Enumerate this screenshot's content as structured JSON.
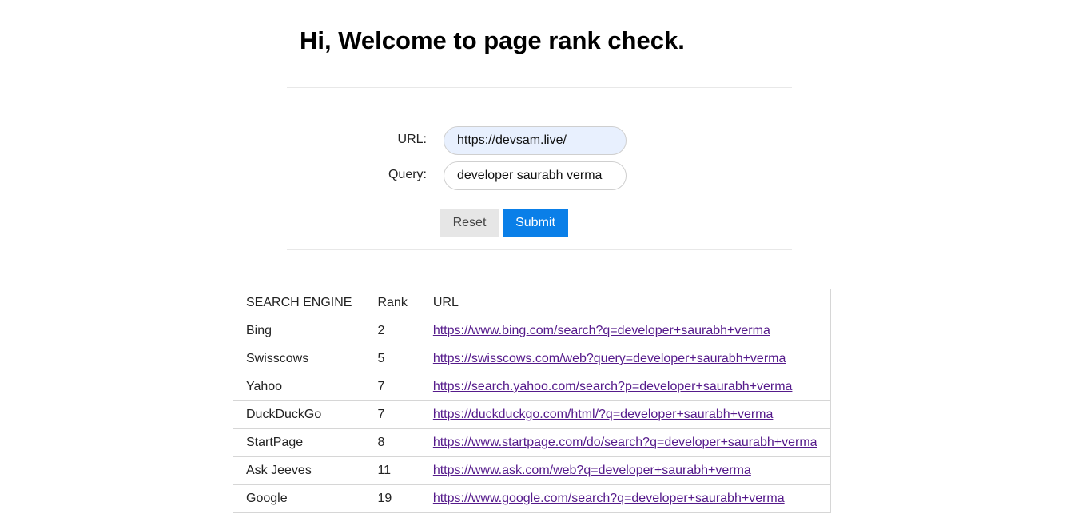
{
  "header": {
    "title": "Hi, Welcome to page rank check."
  },
  "form": {
    "url_label": "URL:",
    "url_value": "https://devsam.live/",
    "query_label": "Query:",
    "query_value": "developer saurabh verma",
    "reset_label": "Reset",
    "submit_label": "Submit"
  },
  "results": {
    "columns": [
      "SEARCH ENGINE",
      "Rank",
      "URL"
    ],
    "rows": [
      {
        "engine": "Bing",
        "rank": "2",
        "url": "https://www.bing.com/search?q=developer+saurabh+verma"
      },
      {
        "engine": "Swisscows",
        "rank": "5",
        "url": "https://swisscows.com/web?query=developer+saurabh+verma"
      },
      {
        "engine": "Yahoo",
        "rank": "7",
        "url": "https://search.yahoo.com/search?p=developer+saurabh+verma"
      },
      {
        "engine": "DuckDuckGo",
        "rank": "7",
        "url": "https://duckduckgo.com/html/?q=developer+saurabh+verma"
      },
      {
        "engine": "StartPage",
        "rank": "8",
        "url": "https://www.startpage.com/do/search?q=developer+saurabh+verma"
      },
      {
        "engine": "Ask Jeeves",
        "rank": "11",
        "url": "https://www.ask.com/web?q=developer+saurabh+verma"
      },
      {
        "engine": "Google",
        "rank": "19",
        "url": "https://www.google.com/search?q=developer+saurabh+verma"
      }
    ]
  },
  "colors": {
    "submit_button": "#0a7fe8",
    "reset_button": "#e6e6e6",
    "link_visited": "#551a8b",
    "autofill_input": "#e8f0fe"
  }
}
